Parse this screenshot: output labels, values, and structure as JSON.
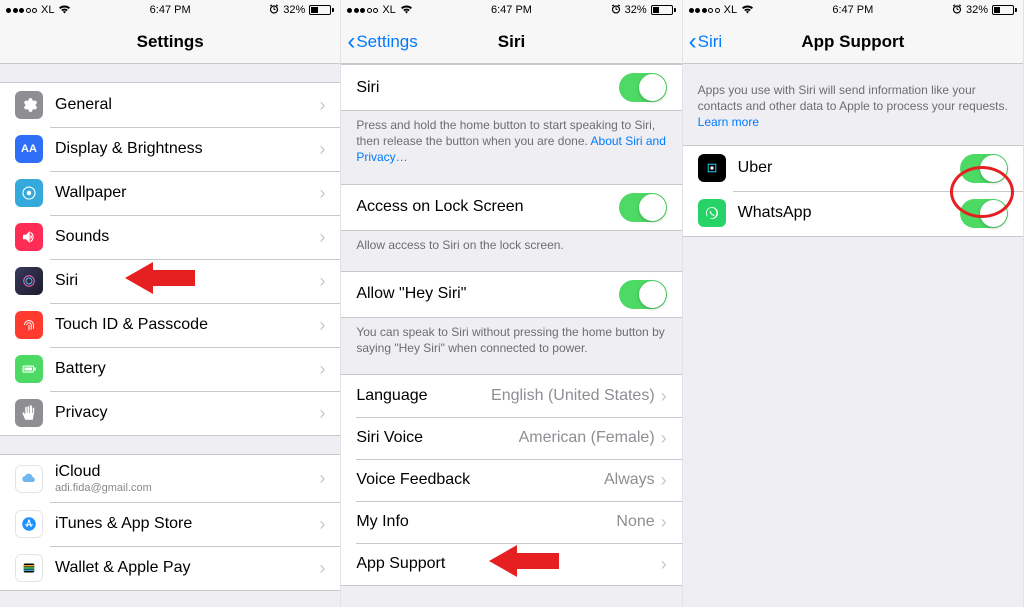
{
  "status": {
    "carrier": "XL",
    "time": "6:47 PM",
    "battery": "32%"
  },
  "screen1": {
    "title": "Settings",
    "groupA": [
      {
        "id": "general",
        "label": "General"
      },
      {
        "id": "display",
        "label": "Display & Brightness"
      },
      {
        "id": "wallpaper",
        "label": "Wallpaper"
      },
      {
        "id": "sounds",
        "label": "Sounds"
      },
      {
        "id": "siri",
        "label": "Siri"
      },
      {
        "id": "touchid",
        "label": "Touch ID & Passcode"
      },
      {
        "id": "battery",
        "label": "Battery"
      },
      {
        "id": "privacy",
        "label": "Privacy"
      }
    ],
    "groupB_icloud_label": "iCloud",
    "groupB_icloud_sub": "adi.fida@gmail.com",
    "groupB_itunes": "iTunes & App Store",
    "groupB_wallet": "Wallet & Apple Pay"
  },
  "screen2": {
    "back": "Settings",
    "title": "Siri",
    "siri_label": "Siri",
    "siri_footer_a": "Press and hold the home button to start speaking to Siri, then release the button when you are done. ",
    "siri_footer_link": "About Siri and Privacy…",
    "lock_label": "Access on Lock Screen",
    "lock_footer": "Allow access to Siri on the lock screen.",
    "hey_label": "Allow \"Hey Siri\"",
    "hey_footer": "You can speak to Siri without pressing the home button by saying \"Hey Siri\" when connected to power.",
    "language_label": "Language",
    "language_value": "English (United States)",
    "voice_label": "Siri Voice",
    "voice_value": "American (Female)",
    "feedback_label": "Voice Feedback",
    "feedback_value": "Always",
    "myinfo_label": "My Info",
    "myinfo_value": "None",
    "appsupport_label": "App Support"
  },
  "screen3": {
    "back": "Siri",
    "title": "App Support",
    "header_a": "Apps you use with Siri will send information like your contacts and other data to Apple to process your requests. ",
    "header_link": "Learn more",
    "uber": "Uber",
    "whatsapp": "WhatsApp"
  }
}
